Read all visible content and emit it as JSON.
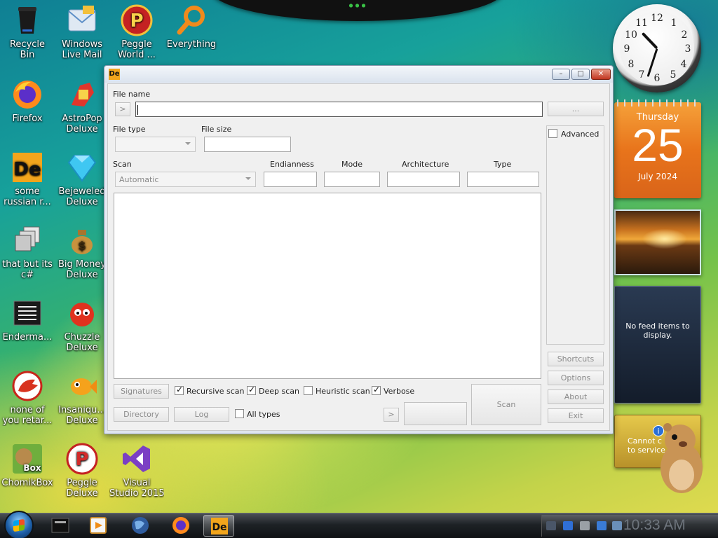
{
  "desktop_icons": [
    {
      "label": "Recycle Bin",
      "label1": "Recycle",
      "label2": "Bin"
    },
    {
      "label": "Windows Live Mail",
      "label1": "Windows",
      "label2": "Live Mail"
    },
    {
      "label": "Peggle World ...",
      "label1": "Peggle",
      "label2": "World ..."
    },
    {
      "label": "Everything",
      "label1": "Everything",
      "label2": ""
    },
    {
      "label": "Firefox",
      "label1": "Firefox",
      "label2": ""
    },
    {
      "label": "AstroPop Deluxe",
      "label1": "AstroPop",
      "label2": "Deluxe"
    },
    {
      "label": "some russian r...",
      "label1": "some",
      "label2": "russian r..."
    },
    {
      "label": "Bejeweled Deluxe",
      "label1": "Bejeweled",
      "label2": "Deluxe"
    },
    {
      "label": "that but its c#",
      "label1": "that but its",
      "label2": "c#"
    },
    {
      "label": "Big Money Deluxe",
      "label1": "Big Money",
      "label2": "Deluxe"
    },
    {
      "label": "Enderma...",
      "label1": "Enderma...",
      "label2": ""
    },
    {
      "label": "Chuzzle Deluxe",
      "label1": "Chuzzle",
      "label2": "Deluxe"
    },
    {
      "label": "none of you retar...",
      "label1": "none of",
      "label2": "you retar..."
    },
    {
      "label": "Insaniquarium Deluxe",
      "label1": "Insaniqu...",
      "label2": "Deluxe"
    },
    {
      "label": "ChomikBox",
      "label1": "ChomikBox",
      "label2": ""
    },
    {
      "label": "Peggle Deluxe",
      "label1": "Peggle",
      "label2": "Deluxe"
    },
    {
      "label": "Visual Studio 2015",
      "label1": "Visual",
      "label2": "Studio 2015"
    }
  ],
  "gadgets": {
    "clock": {
      "numbers": [
        "12",
        "1",
        "2",
        "3",
        "4",
        "5",
        "6",
        "7",
        "8",
        "9",
        "10",
        "11"
      ],
      "hour": 10,
      "minute": 33
    },
    "calendar": {
      "weekday": "Thursday",
      "day": "25",
      "month_year": "July 2024"
    },
    "feed": {
      "message": "No feed items to display."
    },
    "weather": {
      "message_line1": "Cannot c",
      "message_line2": "to service",
      "info_icon": "i"
    }
  },
  "window": {
    "app_icon_text": "De",
    "title_buttons": {
      "minimize": "–",
      "maximize": "□",
      "close": "✕"
    },
    "file_name_label": "File name",
    "arrow_button": ">",
    "file_name_value": "",
    "browse_button": "...",
    "file_type_label": "File type",
    "file_type_value": "",
    "file_size_label": "File size",
    "file_size_value": "",
    "scan_label": "Scan",
    "scan_value": "Automatic",
    "endianness_label": "Endianness",
    "mode_label": "Mode",
    "architecture_label": "Architecture",
    "type_label": "Type",
    "advanced_label": "Advanced",
    "advanced_checked": false,
    "signatures_button": "Signatures",
    "recursive_scan_label": "Recursive scan",
    "deep_scan_label": "Deep scan",
    "heuristic_scan_label": "Heuristic scan",
    "verbose_label": "Verbose",
    "directory_button": "Directory",
    "log_button": "Log",
    "all_types_label": "All types",
    "scan_button": "Scan",
    "side_buttons": {
      "shortcuts": "Shortcuts",
      "options": "Options",
      "about": "About",
      "exit": "Exit"
    }
  },
  "taskbar": {
    "items": [
      "Command Prompt",
      "Media Player",
      "Network",
      "Firefox",
      "Detect It Easy"
    ],
    "clock": "10:33 AM"
  },
  "colors": {
    "accent": "#f2a51c",
    "calendar": "#e8741b",
    "taskbar": "#1e2226"
  }
}
